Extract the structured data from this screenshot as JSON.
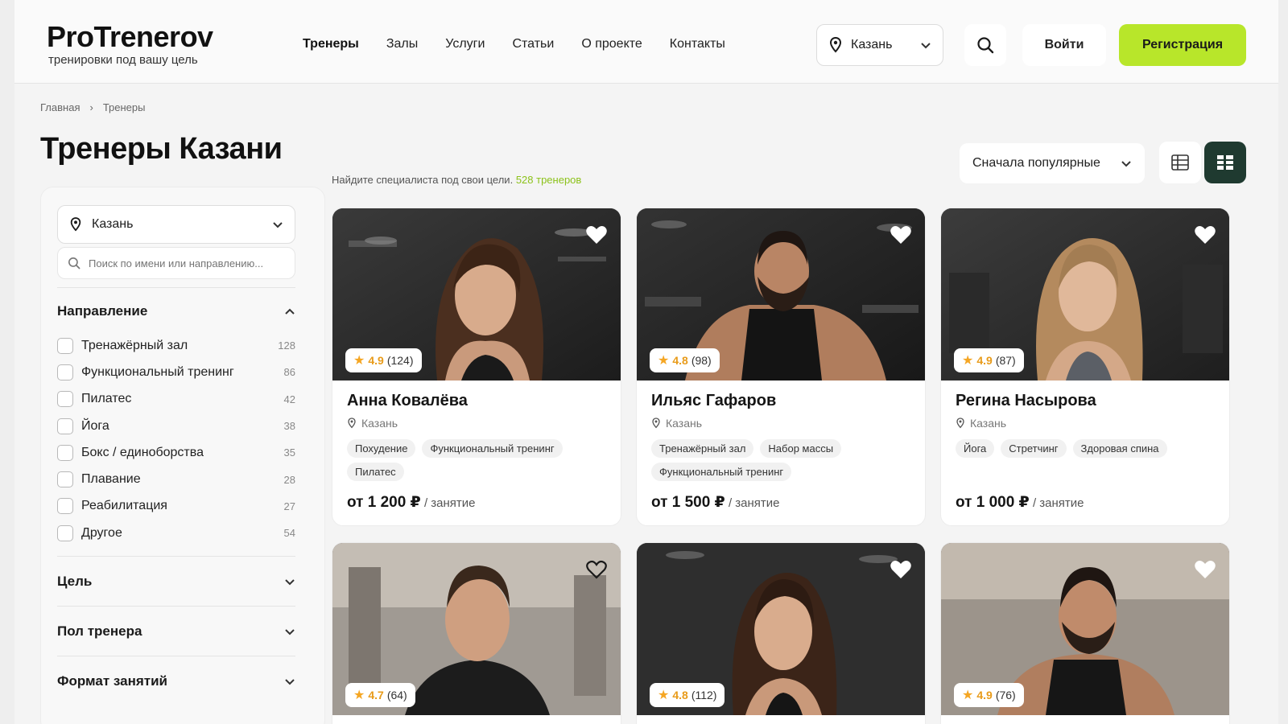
{
  "header": {
    "logo_title": "ProTrenerov",
    "logo_subtitle": "тренировки под вашу цель",
    "nav": [
      "Тренеры",
      "Залы",
      "Услуги",
      "Статьи",
      "О проекте",
      "Контакты"
    ],
    "city": "Казань",
    "login": "Войти",
    "register": "Регистрация"
  },
  "breadcrumb": [
    "Главная",
    "Тренеры"
  ],
  "page_title": "Тренеры Казани",
  "subtitle": {
    "text": "Найдите специалиста под свои цели.",
    "count": "528 тренеров"
  },
  "sort": "Сначала популярные",
  "sidebar": {
    "city": "Казань",
    "search_placeholder": "Поиск по имени или направлению...",
    "direction_title": "Направление",
    "directions": [
      {
        "label": "Тренажёрный зал",
        "count": "128"
      },
      {
        "label": "Функциональный тренинг",
        "count": "86"
      },
      {
        "label": "Пилатес",
        "count": "42"
      },
      {
        "label": "Йога",
        "count": "38"
      },
      {
        "label": "Бокс / единоборства",
        "count": "35"
      },
      {
        "label": "Плавание",
        "count": "28"
      },
      {
        "label": "Реабилитация",
        "count": "27"
      },
      {
        "label": "Другое",
        "count": "54"
      }
    ],
    "goal_title": "Цель",
    "gender_title": "Пол тренера",
    "format_title": "Формат занятий"
  },
  "colors": {
    "accent": "#b8e62a",
    "dark_green": "#1f3a30",
    "rating": "#e89b1a"
  },
  "trainers": [
    {
      "name": "Анна Ковалёва",
      "city": "Казань",
      "rating": "4.9",
      "reviews": "(124)",
      "tags": [
        "Похудение",
        "Функциональный тренинг",
        "Пилатес"
      ],
      "price": "от 1 200 ₽",
      "unit": "/ занятие"
    },
    {
      "name": "Ильяс Гафаров",
      "city": "Казань",
      "rating": "4.8",
      "reviews": "(98)",
      "tags": [
        "Тренажёрный зал",
        "Набор массы",
        "Функциональный тренинг"
      ],
      "price": "от 1 500 ₽",
      "unit": "/ занятие"
    },
    {
      "name": "Регина Насырова",
      "city": "Казань",
      "rating": "4.9",
      "reviews": "(87)",
      "tags": [
        "Йога",
        "Стретчинг",
        "Здоровая спина"
      ],
      "price": "от 1 000 ₽",
      "unit": "/ занятие"
    },
    {
      "rating": "4.7",
      "reviews": "(64)"
    },
    {
      "rating": "4.8",
      "reviews": "(112)"
    },
    {
      "rating": "4.9",
      "reviews": "(76)"
    }
  ]
}
